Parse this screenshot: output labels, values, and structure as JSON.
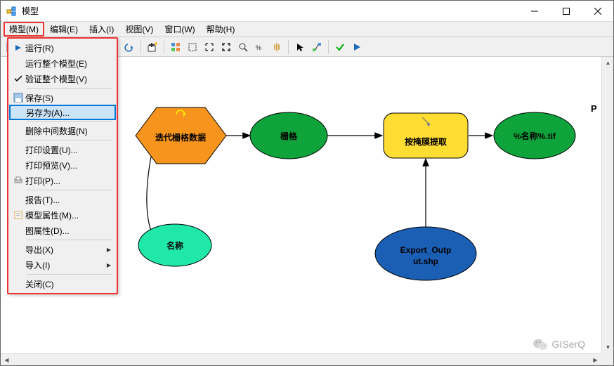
{
  "window": {
    "title": "模型"
  },
  "menubar": {
    "items": [
      "模型(M)",
      "编辑(E)",
      "插入(I)",
      "视图(V)",
      "窗口(W)",
      "帮助(H)"
    ],
    "active_index": 0
  },
  "dropdown": {
    "items": [
      {
        "icon": "run-icon",
        "label": "运行(R)"
      },
      {
        "icon": "",
        "label": "运行整个模型(E)"
      },
      {
        "icon": "check-icon",
        "label": "验证整个模型(V)"
      },
      {
        "sep": true
      },
      {
        "icon": "save-icon",
        "label": "保存(S)"
      },
      {
        "icon": "",
        "label": "另存为(A)...",
        "highlighted": true
      },
      {
        "sep": true
      },
      {
        "icon": "",
        "label": "删除中间数据(N)"
      },
      {
        "sep": true
      },
      {
        "icon": "",
        "label": "打印设置(U)..."
      },
      {
        "icon": "",
        "label": "打印预览(V)..."
      },
      {
        "icon": "print-icon",
        "label": "打印(P)..."
      },
      {
        "sep": true
      },
      {
        "icon": "",
        "label": "报告(T)..."
      },
      {
        "icon": "props-icon",
        "label": "模型属性(M)..."
      },
      {
        "icon": "",
        "label": "图属性(D)..."
      },
      {
        "sep": true
      },
      {
        "icon": "",
        "label": "导出(X)",
        "submenu": true
      },
      {
        "icon": "",
        "label": "导入(I)",
        "submenu": true
      },
      {
        "sep": true
      },
      {
        "icon": "",
        "label": "关闭(C)"
      }
    ]
  },
  "canvas": {
    "nodes": {
      "iterator": {
        "label": "迭代栅格数据"
      },
      "raster": {
        "label": "栅格"
      },
      "name": {
        "label": "名称"
      },
      "extract": {
        "label": "按掩膜提取"
      },
      "output": {
        "label": "%名称%.tif"
      },
      "export": {
        "label_line1": "Export_Outp",
        "label_line2": "ut.shp"
      }
    },
    "param_marker": "P"
  },
  "watermark": {
    "text": "GISerQ"
  }
}
